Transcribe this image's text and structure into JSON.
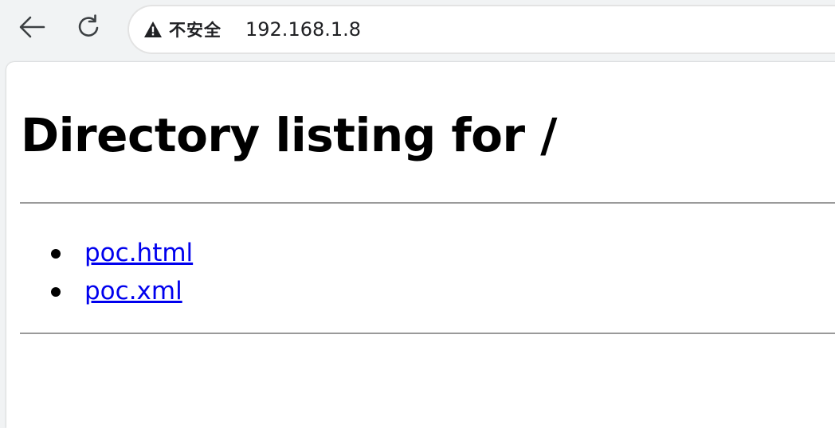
{
  "browser": {
    "back_icon": "arrow-left-icon",
    "reload_icon": "reload-icon",
    "security": {
      "icon": "warning-icon",
      "label": "不安全"
    },
    "url": "192.168.1.8"
  },
  "page": {
    "title": "Directory listing for /",
    "files": [
      {
        "name": "poc.html"
      },
      {
        "name": "poc.xml"
      }
    ],
    "link_color": "#0000ee"
  }
}
